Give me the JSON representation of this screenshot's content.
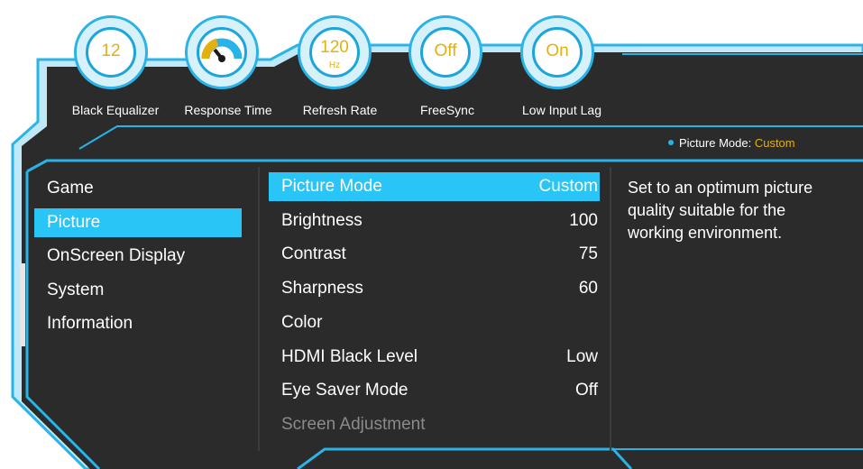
{
  "dials": [
    {
      "id": "black-equalizer",
      "value": "12",
      "unit": "",
      "label": "Black Equalizer"
    },
    {
      "id": "response-time",
      "value": "",
      "unit": "",
      "label": "Response Time",
      "icon": "speedometer-gauge-icon"
    },
    {
      "id": "refresh-rate",
      "value": "120",
      "unit": "Hz",
      "label": "Refresh Rate"
    },
    {
      "id": "freesync",
      "value": "Off",
      "unit": "",
      "label": "FreeSync"
    },
    {
      "id": "low-input-lag",
      "value": "On",
      "unit": "",
      "label": "Low Input Lag"
    }
  ],
  "status": {
    "label": "Picture Mode:",
    "value": "Custom"
  },
  "left_menu": {
    "items": [
      "Game",
      "Picture",
      "OnScreen Display",
      "System",
      "Information"
    ],
    "selected_index": 1
  },
  "middle_menu": {
    "items": [
      {
        "label": "Picture Mode",
        "value": "Custom",
        "selected": true,
        "disabled": false
      },
      {
        "label": "Brightness",
        "value": "100",
        "selected": false,
        "disabled": false
      },
      {
        "label": "Contrast",
        "value": "75",
        "selected": false,
        "disabled": false
      },
      {
        "label": "Sharpness",
        "value": "60",
        "selected": false,
        "disabled": false
      },
      {
        "label": "Color",
        "value": "",
        "selected": false,
        "disabled": false
      },
      {
        "label": "HDMI Black Level",
        "value": "Low",
        "selected": false,
        "disabled": false
      },
      {
        "label": "Eye Saver Mode",
        "value": "Off",
        "selected": false,
        "disabled": false
      },
      {
        "label": "Screen Adjustment",
        "value": "",
        "selected": false,
        "disabled": true
      }
    ]
  },
  "description": "Set to an optimum picture quality suitable for the working environment.",
  "colors": {
    "accent": "#29c5f6",
    "outline": "#29b3e6",
    "panel": "#2b2b2b",
    "highlight_text": "#e3b00f",
    "disabled_text": "#8b8b8b"
  }
}
